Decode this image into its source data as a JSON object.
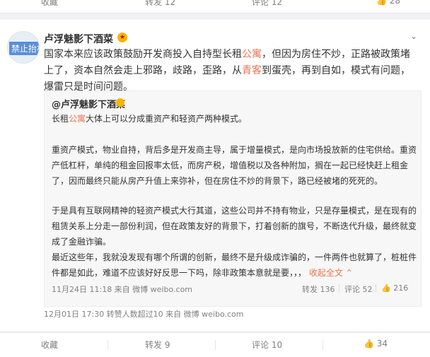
{
  "top_actions": {
    "collect": "收藏",
    "repost": "转发 12",
    "comment": "评论 12",
    "like": "28"
  },
  "post": {
    "author": "卢浮魅影下酒菜",
    "avatar_text": "禁止抬杠",
    "text_before_1": "国家本来应该政策鼓励开发商投入自持型长租",
    "keyword_1": "公寓",
    "text_middle": "，但因为房住不炒，正路被政策堵上了，资本自然会走上邪路，歧路，歪路，从",
    "keyword_2": "青客",
    "text_end": "到蛋壳，再到自如，模式有问题，爆雷只是时间问题。",
    "footer": "12月01日 17:30 转赞人数超过10 来自 微博 weibo.com"
  },
  "repost": {
    "author": "@卢浮魅影下酒菜",
    "p1_before": "长租",
    "p1_keyword": "公寓",
    "p1_after": "大体上可以分成重资产和轻资产两种模式。",
    "p2": "重资产模式，物业自持，背后多是开发商主导，属于增量模式，是向市场投放新的住宅供给。重资产低杠杆，单纯的租金回报率太低，而房产税，增值税以及各种附加，搁在一起已经快赶上租金了，因而最终只能从房产升值上来弥补，但在房住不炒的背景下，路已经被堵的死死的。",
    "p3": "于是具有互联网精神的轻资产模式大行其道，这些公司并不持有物业，只是存量模式，是在现有的租赁关系上分走一部份利润，但在政策友好的背景下，打着创新的旗号，不断迭代升级，最终就变成了金融诈骗。",
    "p4": "最近这些年，我就没发现有哪个所谓的创新，最终不是升级成诈骗的，一件两件也就算了，桩桩件件都是如此，难道不应该好好反思一下吗，除非政策本意就是要，，，",
    "more": "收起全文",
    "footer": "11月24日 11:18 来自 微博 weibo.com",
    "repost_count": "转发 136",
    "comment_count": "评论 52",
    "like_count": "216"
  },
  "bottom_actions": {
    "collect": "收藏",
    "repost": "转发 9",
    "comment": "评论 10",
    "like": "34"
  }
}
